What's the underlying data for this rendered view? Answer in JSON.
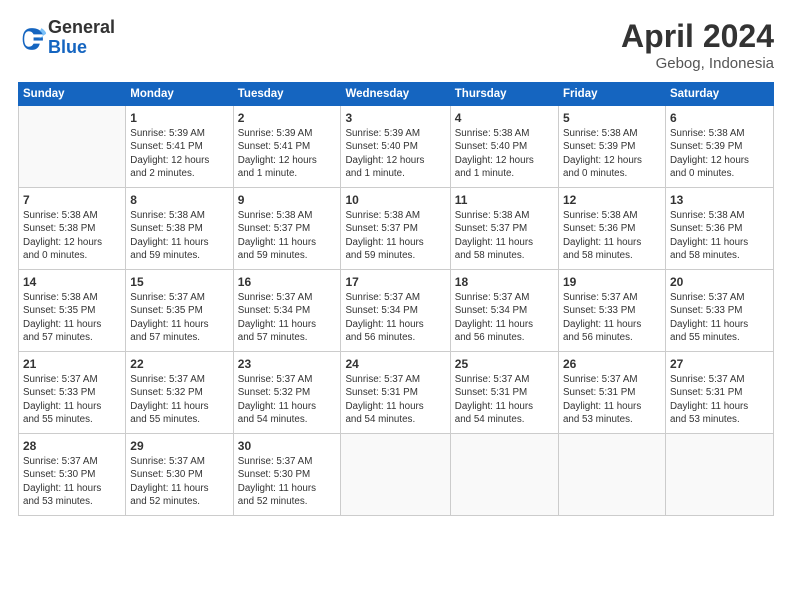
{
  "header": {
    "logo_general": "General",
    "logo_blue": "Blue",
    "title": "April 2024",
    "location": "Gebog, Indonesia"
  },
  "weekdays": [
    "Sunday",
    "Monday",
    "Tuesday",
    "Wednesday",
    "Thursday",
    "Friday",
    "Saturday"
  ],
  "weeks": [
    [
      {
        "day": "",
        "info": ""
      },
      {
        "day": "1",
        "info": "Sunrise: 5:39 AM\nSunset: 5:41 PM\nDaylight: 12 hours\nand 2 minutes."
      },
      {
        "day": "2",
        "info": "Sunrise: 5:39 AM\nSunset: 5:41 PM\nDaylight: 12 hours\nand 1 minute."
      },
      {
        "day": "3",
        "info": "Sunrise: 5:39 AM\nSunset: 5:40 PM\nDaylight: 12 hours\nand 1 minute."
      },
      {
        "day": "4",
        "info": "Sunrise: 5:38 AM\nSunset: 5:40 PM\nDaylight: 12 hours\nand 1 minute."
      },
      {
        "day": "5",
        "info": "Sunrise: 5:38 AM\nSunset: 5:39 PM\nDaylight: 12 hours\nand 0 minutes."
      },
      {
        "day": "6",
        "info": "Sunrise: 5:38 AM\nSunset: 5:39 PM\nDaylight: 12 hours\nand 0 minutes."
      }
    ],
    [
      {
        "day": "7",
        "info": "Sunrise: 5:38 AM\nSunset: 5:38 PM\nDaylight: 12 hours\nand 0 minutes."
      },
      {
        "day": "8",
        "info": "Sunrise: 5:38 AM\nSunset: 5:38 PM\nDaylight: 11 hours\nand 59 minutes."
      },
      {
        "day": "9",
        "info": "Sunrise: 5:38 AM\nSunset: 5:37 PM\nDaylight: 11 hours\nand 59 minutes."
      },
      {
        "day": "10",
        "info": "Sunrise: 5:38 AM\nSunset: 5:37 PM\nDaylight: 11 hours\nand 59 minutes."
      },
      {
        "day": "11",
        "info": "Sunrise: 5:38 AM\nSunset: 5:37 PM\nDaylight: 11 hours\nand 58 minutes."
      },
      {
        "day": "12",
        "info": "Sunrise: 5:38 AM\nSunset: 5:36 PM\nDaylight: 11 hours\nand 58 minutes."
      },
      {
        "day": "13",
        "info": "Sunrise: 5:38 AM\nSunset: 5:36 PM\nDaylight: 11 hours\nand 58 minutes."
      }
    ],
    [
      {
        "day": "14",
        "info": "Sunrise: 5:38 AM\nSunset: 5:35 PM\nDaylight: 11 hours\nand 57 minutes."
      },
      {
        "day": "15",
        "info": "Sunrise: 5:37 AM\nSunset: 5:35 PM\nDaylight: 11 hours\nand 57 minutes."
      },
      {
        "day": "16",
        "info": "Sunrise: 5:37 AM\nSunset: 5:34 PM\nDaylight: 11 hours\nand 57 minutes."
      },
      {
        "day": "17",
        "info": "Sunrise: 5:37 AM\nSunset: 5:34 PM\nDaylight: 11 hours\nand 56 minutes."
      },
      {
        "day": "18",
        "info": "Sunrise: 5:37 AM\nSunset: 5:34 PM\nDaylight: 11 hours\nand 56 minutes."
      },
      {
        "day": "19",
        "info": "Sunrise: 5:37 AM\nSunset: 5:33 PM\nDaylight: 11 hours\nand 56 minutes."
      },
      {
        "day": "20",
        "info": "Sunrise: 5:37 AM\nSunset: 5:33 PM\nDaylight: 11 hours\nand 55 minutes."
      }
    ],
    [
      {
        "day": "21",
        "info": "Sunrise: 5:37 AM\nSunset: 5:33 PM\nDaylight: 11 hours\nand 55 minutes."
      },
      {
        "day": "22",
        "info": "Sunrise: 5:37 AM\nSunset: 5:32 PM\nDaylight: 11 hours\nand 55 minutes."
      },
      {
        "day": "23",
        "info": "Sunrise: 5:37 AM\nSunset: 5:32 PM\nDaylight: 11 hours\nand 54 minutes."
      },
      {
        "day": "24",
        "info": "Sunrise: 5:37 AM\nSunset: 5:31 PM\nDaylight: 11 hours\nand 54 minutes."
      },
      {
        "day": "25",
        "info": "Sunrise: 5:37 AM\nSunset: 5:31 PM\nDaylight: 11 hours\nand 54 minutes."
      },
      {
        "day": "26",
        "info": "Sunrise: 5:37 AM\nSunset: 5:31 PM\nDaylight: 11 hours\nand 53 minutes."
      },
      {
        "day": "27",
        "info": "Sunrise: 5:37 AM\nSunset: 5:31 PM\nDaylight: 11 hours\nand 53 minutes."
      }
    ],
    [
      {
        "day": "28",
        "info": "Sunrise: 5:37 AM\nSunset: 5:30 PM\nDaylight: 11 hours\nand 53 minutes."
      },
      {
        "day": "29",
        "info": "Sunrise: 5:37 AM\nSunset: 5:30 PM\nDaylight: 11 hours\nand 52 minutes."
      },
      {
        "day": "30",
        "info": "Sunrise: 5:37 AM\nSunset: 5:30 PM\nDaylight: 11 hours\nand 52 minutes."
      },
      {
        "day": "",
        "info": ""
      },
      {
        "day": "",
        "info": ""
      },
      {
        "day": "",
        "info": ""
      },
      {
        "day": "",
        "info": ""
      }
    ]
  ]
}
